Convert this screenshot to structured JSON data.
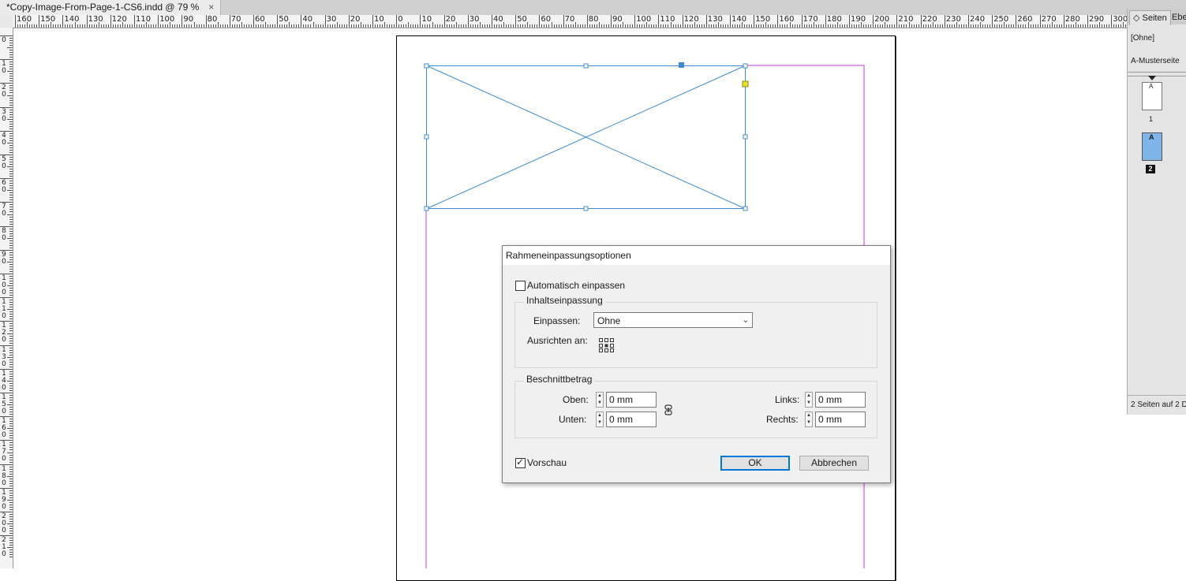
{
  "tab": {
    "title": "*Copy-Image-From-Page-1-CS6.indd @ 79 %",
    "close": "×"
  },
  "ruler": {
    "h_labels": [
      "160",
      "150",
      "140",
      "130",
      "120",
      "110",
      "100",
      "90",
      "80",
      "70",
      "60",
      "50",
      "40",
      "30",
      "20",
      "10",
      "0",
      "10",
      "20",
      "30",
      "40",
      "50",
      "60",
      "70",
      "80",
      "90",
      "100",
      "110",
      "120",
      "130",
      "140",
      "150",
      "160",
      "170",
      "180",
      "190",
      "200",
      "210",
      "220",
      "230",
      "240",
      "250",
      "260",
      "270",
      "280",
      "290",
      "300"
    ],
    "v_labels": [
      "0",
      "10",
      "20",
      "30",
      "40",
      "50",
      "60",
      "70",
      "80",
      "90",
      "100",
      "110",
      "120",
      "130",
      "140",
      "150",
      "160",
      "170",
      "180",
      "190",
      "200",
      "210"
    ]
  },
  "panel": {
    "tab_pages": "◇ Seiten",
    "tab_layers": "Eben",
    "none_master": "[Ohne]",
    "a_master": "A-Musterseite",
    "page1_master": "A",
    "page1_number": "1",
    "page2_master": "A",
    "page2_number": "2",
    "status": "2 Seiten auf 2 Dr"
  },
  "dialog": {
    "title": "Rahmeneinpassungsoptionen",
    "auto_fit_label": "Automatisch einpassen",
    "auto_fit_checked": false,
    "content_group": "Inhaltseinpassung",
    "fit_label": "Einpassen:",
    "fit_value": "Ohne",
    "align_label": "Ausrichten an:",
    "crop_group": "Beschnittbetrag",
    "top_label": "Oben:",
    "top_value": "0 mm",
    "bottom_label": "Unten:",
    "bottom_value": "0 mm",
    "left_label": "Links:",
    "left_value": "0 mm",
    "right_label": "Rechts:",
    "right_value": "0 mm",
    "preview_label": "Vorschau",
    "preview_checked": true,
    "ok_label": "OK",
    "cancel_label": "Abbrechen"
  },
  "colors": {
    "frame": "#3d8bd4",
    "margin": "#c23bd4",
    "selected_page": "#7fb5e8",
    "handle_yellow": "#e8e02a"
  }
}
